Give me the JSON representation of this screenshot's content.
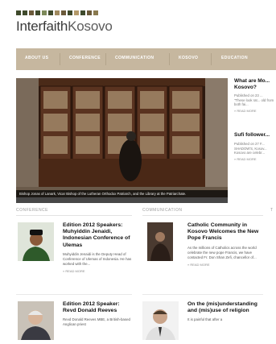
{
  "brand": {
    "logo_left": "Interfaith",
    "logo_right": "Kosovo",
    "squares": [
      "#3f4a2c",
      "#3f4a2c",
      "#6b5a3a",
      "#3f4a2c",
      "#7d8a5a",
      "#3f4a2c",
      "#a08a5f",
      "#6b5a3a",
      "#3f4a2c",
      "#b49a6a",
      "#3f4a2c",
      "#6b5a3a",
      "#8a7a4f"
    ]
  },
  "nav": {
    "items": [
      "About Us",
      "Conference",
      "Communication",
      "Kosovo",
      "Education"
    ]
  },
  "hero": {
    "caption": "Bishop Jonas of Lanark, Vicar Bishop of the Lutheran Orthodox Patriarch, and the Library at the Patriarchate."
  },
  "sidebar": {
    "items": [
      {
        "title": "What are Mo... Kosovo?",
        "meta": "Published on 23 ...",
        "excerpt": "\"These look rat... old from both fai...",
        "more": "» READ MORE"
      },
      {
        "title": "Sufi follower...",
        "meta": "Published on 27 F...",
        "excerpt": "SHADOW'S, Kosov... Kosovo are celebr...",
        "more": "» READ MORE"
      }
    ],
    "edge_label": "T"
  },
  "conference": {
    "heading": "Conference",
    "articles": [
      {
        "title": "Edition 2012 Speakers: Muhyiddin Jenaidi, Indonesian Conference of Ulemas",
        "body": "Muhyiddin Jenaidi is the Deputy Head of Conference of Ulemas of Indonesia. He has worked with the...",
        "more": "» READ MORE"
      },
      {
        "title": "Edition 2012 Speaker: Revd Donald Reeves",
        "body": "Revd Donald Reeves MBE, a British-based Anglican priest",
        "more": ""
      }
    ]
  },
  "communication": {
    "heading": "Communication",
    "articles": [
      {
        "title": "Catholic Community in Kosovo Welcomes the New Pope Francis",
        "body": "As the millions of Catholics across the world celebrate the new pope Francis, we have contacted Fr. Don Shan Zefi, chancellor of...",
        "more": "» READ MORE"
      },
      {
        "title": "On the (mis)understanding and (mis)use of religion",
        "body": "It is painful that after a",
        "more": ""
      }
    ]
  }
}
